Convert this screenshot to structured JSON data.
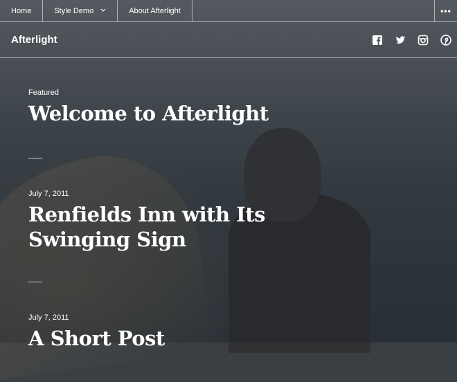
{
  "nav": {
    "items": [
      {
        "label": "Home"
      },
      {
        "label": "Style Demo"
      },
      {
        "label": "About Afterlight"
      }
    ],
    "more_label": "•••"
  },
  "header": {
    "site_title": "Afterlight",
    "social": [
      "facebook-icon",
      "twitter-icon",
      "instagram-icon",
      "pinterest-icon"
    ]
  },
  "posts": [
    {
      "meta": "Featured",
      "title": "Welcome to Afterlight"
    },
    {
      "meta": "July 7, 2011",
      "title_line1": "Renfields Inn with Its",
      "title_line2": "Swinging Sign"
    },
    {
      "meta": "July 7, 2011",
      "title": "A Short Post"
    }
  ]
}
